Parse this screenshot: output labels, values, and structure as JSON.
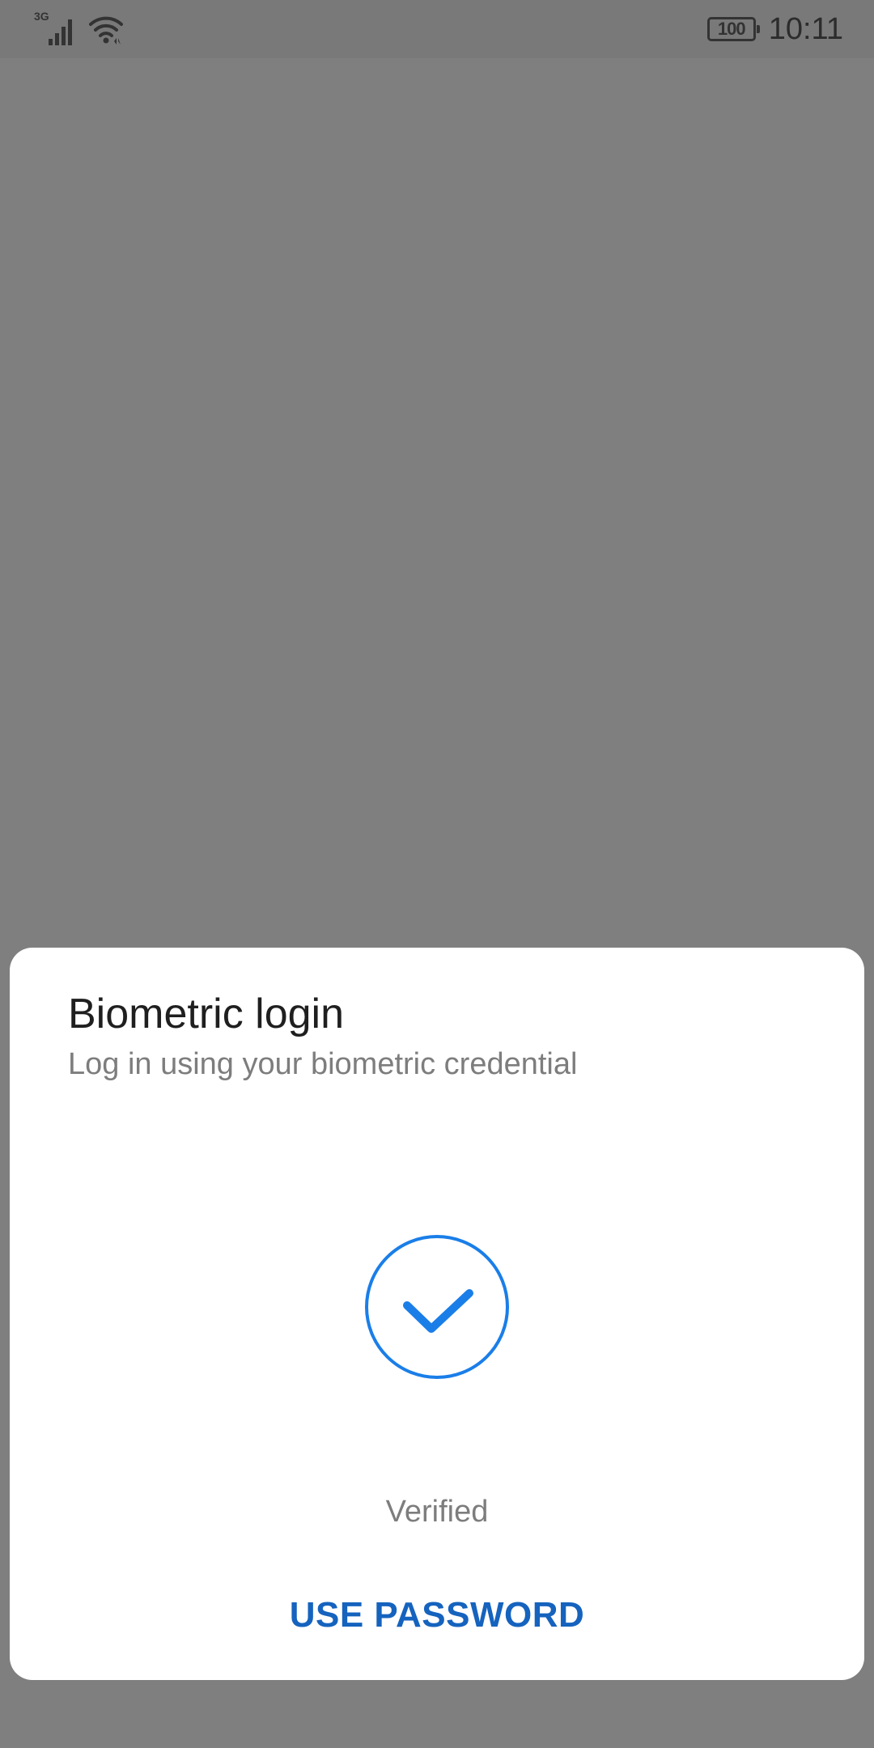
{
  "status_bar": {
    "network_type": "3G",
    "signal_icon": "signal-bars-icon",
    "wifi_icon": "wifi-icon",
    "battery_level": "100",
    "time": "10:11"
  },
  "dialog": {
    "title": "Biometric login",
    "subtitle": "Log in using your biometric credential",
    "status_icon": "checkmark-circle-icon",
    "status_text": "Verified",
    "use_password_label": "USE PASSWORD"
  },
  "colors": {
    "scrim": "#7f7f7f",
    "accent": "#1a7ee8",
    "button_text": "#1563be"
  }
}
